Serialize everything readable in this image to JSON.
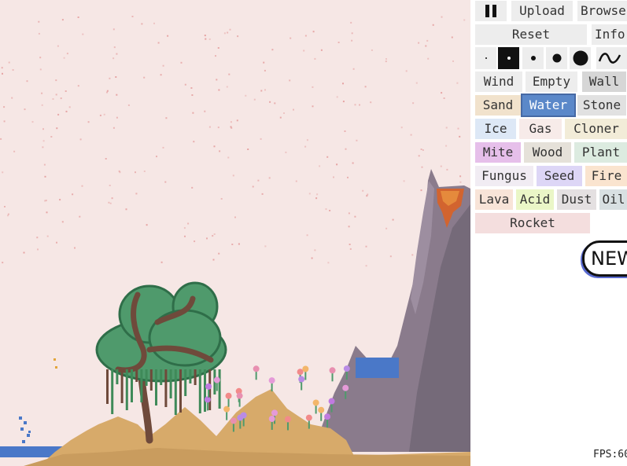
{
  "toolbar": {
    "upload_label": "Upload",
    "browse_label": "Browse",
    "reset_label": "Reset",
    "info_label": "Info"
  },
  "brush_sizes": [
    "tiny",
    "small",
    "medium",
    "large",
    "xlarge"
  ],
  "brush_selected": "small",
  "elements": {
    "wind": {
      "label": "Wind",
      "color": "#ededed"
    },
    "empty": {
      "label": "Empty",
      "color": "#ededed"
    },
    "wall": {
      "label": "Wall",
      "color": "#d6d6d6"
    },
    "sand": {
      "label": "Sand",
      "color": "#f1e2cc"
    },
    "water": {
      "label": "Water",
      "color": "#5b88c9"
    },
    "stone": {
      "label": "Stone",
      "color": "#e1e1e1"
    },
    "ice": {
      "label": "Ice",
      "color": "#dde8f6"
    },
    "gas": {
      "label": "Gas",
      "color": "#f7ebe9"
    },
    "cloner": {
      "label": "Cloner",
      "color": "#f2ecd8"
    },
    "mite": {
      "label": "Mite",
      "color": "#e6bfea"
    },
    "wood": {
      "label": "Wood",
      "color": "#e5e1d9"
    },
    "plant": {
      "label": "Plant",
      "color": "#dcebe0"
    },
    "fungus": {
      "label": "Fungus",
      "color": "#f1ecf3"
    },
    "seed": {
      "label": "Seed",
      "color": "#ddd6f6"
    },
    "fire": {
      "label": "Fire",
      "color": "#fae4cf"
    },
    "lava": {
      "label": "Lava",
      "color": "#f8e4d8"
    },
    "acid": {
      "label": "Acid",
      "color": "#eaf6c7"
    },
    "dust": {
      "label": "Dust",
      "color": "#e4e0e1"
    },
    "oil": {
      "label": "Oil",
      "color": "#d8e0e2"
    },
    "rocket": {
      "label": "Rocket",
      "color": "#f4dede"
    }
  },
  "selected_element": "water",
  "new_badge": "NEW",
  "fps": "FPS:60"
}
